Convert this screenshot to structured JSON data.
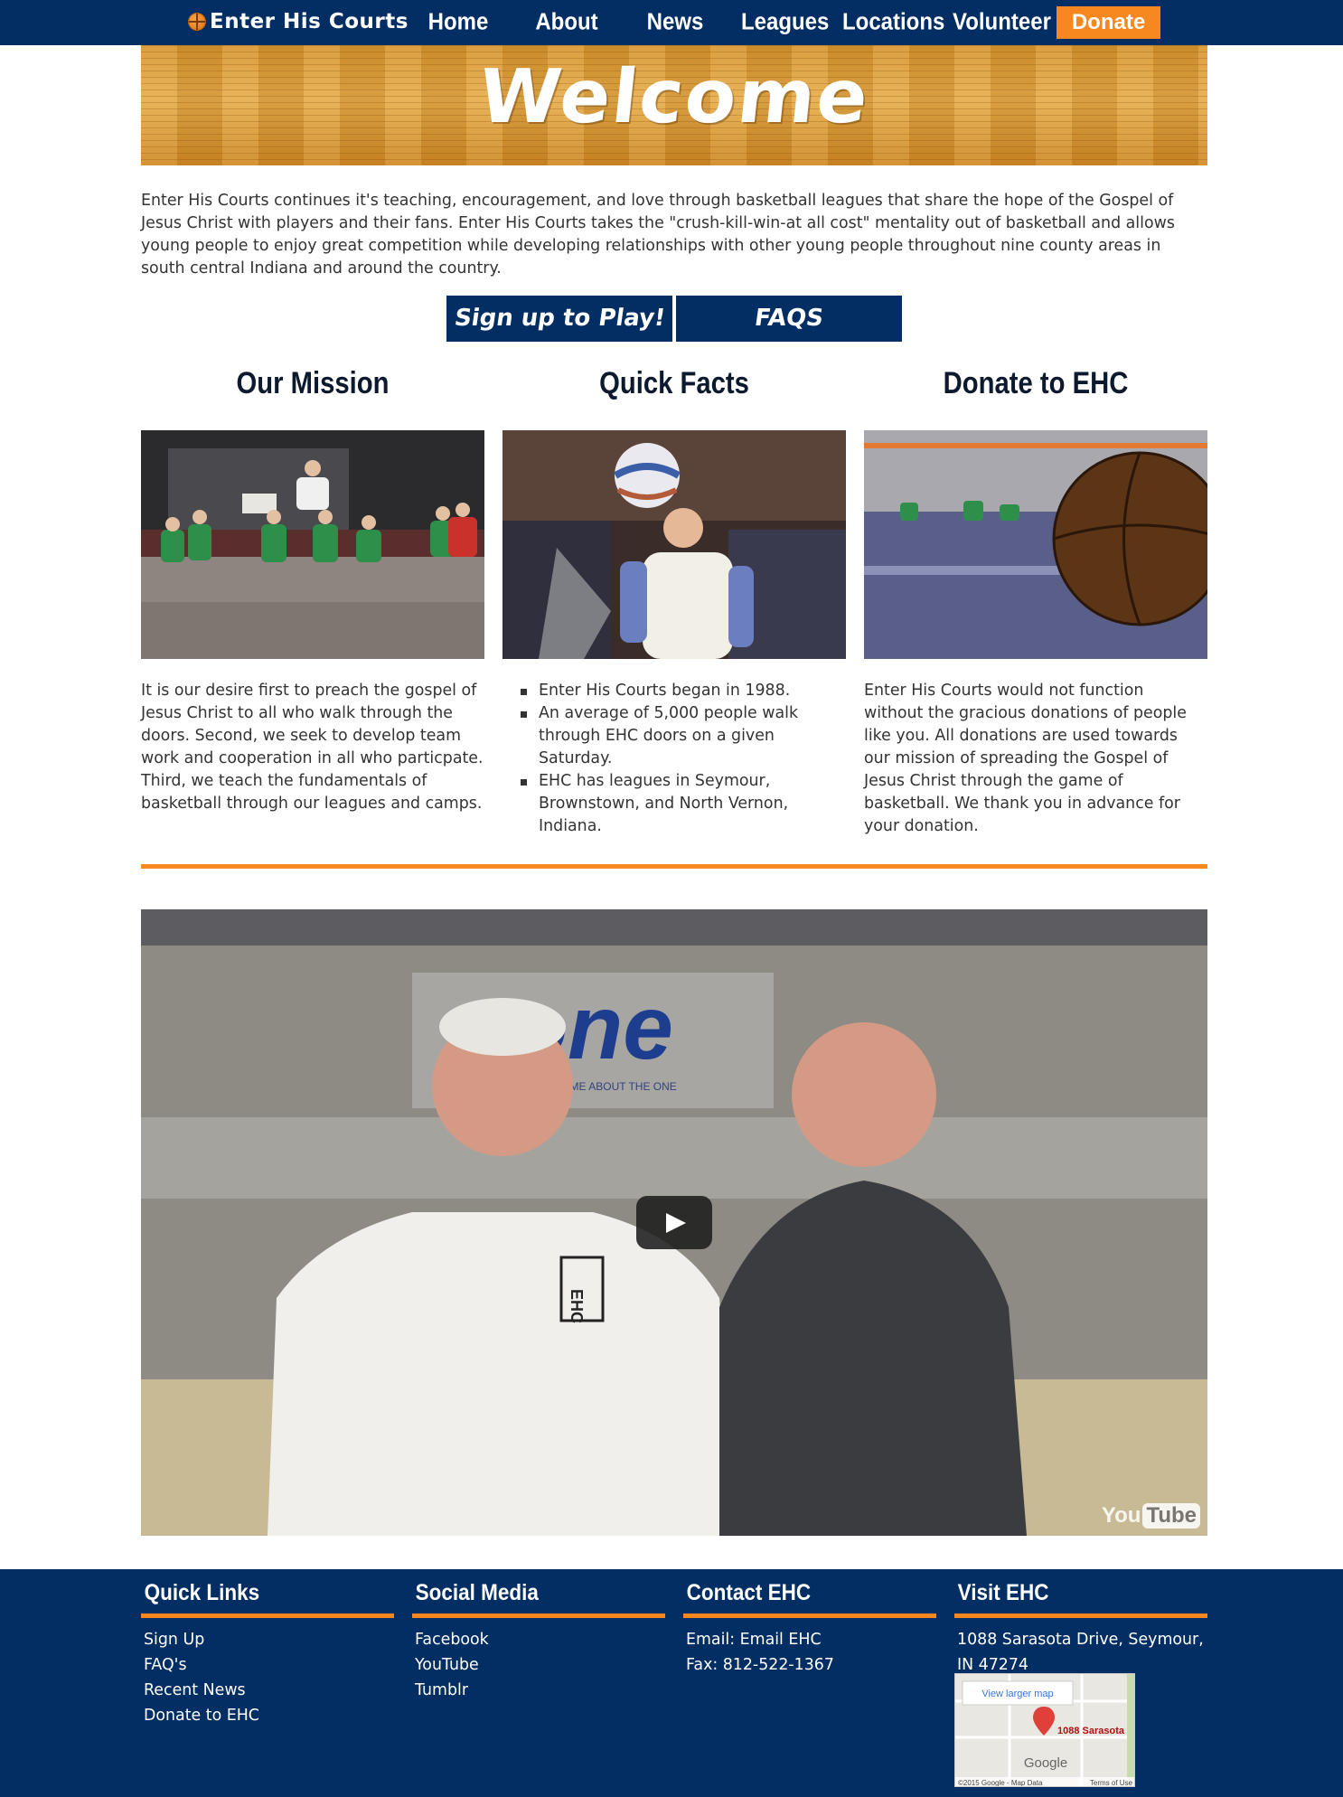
{
  "nav": {
    "logo": "Enter His Courts",
    "items": [
      "Home",
      "About",
      "News",
      "Leagues",
      "Locations",
      "Volunteer"
    ],
    "donate": "Donate"
  },
  "banner": {
    "title": "Welcome"
  },
  "intro": "Enter His Courts continues it's teaching, encouragement, and love through basketball leagues that share the hope of the Gospel of Jesus Christ with players and their fans. Enter His Courts takes the \"crush-kill-win-at all cost\" mentality out of basketball and allows young people to enjoy great competition while developing relationships with other young people throughout nine county areas in south central Indiana and around the country.",
  "cta": {
    "signup": "Sign up to Play!",
    "faqs": "FAQS"
  },
  "columns": {
    "mission": {
      "title": "Our Mission",
      "text": "It is our desire first to preach the gospel of Jesus Christ to all who walk through the doors. Second, we seek to develop team work and cooperation in all who particpate. Third, we teach the fundamentals of basketball through our leagues and camps."
    },
    "facts": {
      "title": "Quick Facts",
      "items": [
        "Enter His Courts began in 1988.",
        "An average of 5,000 people walk through EHC doors on a given Saturday.",
        "EHC has leagues in Seymour, Brownstown, and North Vernon, Indiana."
      ]
    },
    "donate": {
      "title": "Donate to EHC",
      "text": "Enter His Courts would not function without the gracious donations of people like you. All donations are used towards our mission of spreading the Gospel of Jesus Christ through the game of basketball. We thank you in advance for your donation."
    }
  },
  "video": {
    "brand_left": "You",
    "brand_right": "Tube",
    "backdrop_text": "one",
    "backdrop_sub": "ASK ME ABOUT THE ONE",
    "shirt_text": "EHC"
  },
  "footer": {
    "quick_links": {
      "title": "Quick Links",
      "links": [
        "Sign Up",
        "FAQ's",
        "Recent News",
        "Donate to EHC"
      ]
    },
    "social": {
      "title": "Social Media",
      "links": [
        "Facebook",
        "YouTube",
        "Tumblr"
      ]
    },
    "contact": {
      "title": "Contact EHC",
      "lines": [
        "Email: Email EHC",
        "Fax: 812-522-1367"
      ]
    },
    "visit": {
      "title": "Visit EHC",
      "address": "1088 Sarasota Drive, Seymour, IN 47274",
      "map_link": "View larger map",
      "map_pin_label": "1088 Sarasota",
      "map_brand": "Google",
      "map_footer_left": "©2015 Google - Map Data",
      "map_footer_right": "Terms of Use"
    }
  },
  "colors": {
    "navy": "#022e64",
    "orange": "#f6881f"
  }
}
